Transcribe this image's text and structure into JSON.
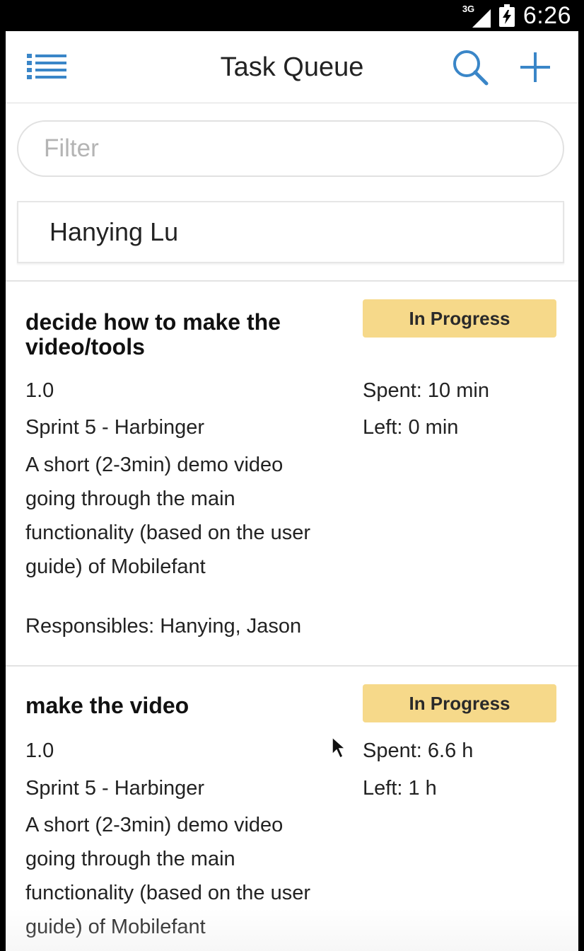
{
  "status_bar": {
    "network": "3G",
    "time": "6:26"
  },
  "header": {
    "title": "Task Queue"
  },
  "filter": {
    "placeholder": "Filter",
    "value": ""
  },
  "assignee": "Hanying Lu",
  "tasks": [
    {
      "name": "decide how to make the video/tools",
      "status": "In Progress",
      "version": "1.0",
      "sprint": "Sprint 5 - Harbinger",
      "description": "A short (2-3min) demo video going through the main functionality (based on the user guide) of Mobilefant",
      "spent": "Spent: 10 min",
      "left": "Left: 0 min",
      "responsibles": "Responsibles: Hanying, Jason"
    },
    {
      "name": "make the video",
      "status": "In Progress",
      "version": "1.0",
      "sprint": "Sprint 5 - Harbinger",
      "description": "A short (2-3min) demo video going through the main functionality (based on the user guide) of Mobilefant",
      "spent": "Spent: 6.6 h",
      "left": "Left: 1 h"
    }
  ],
  "colors": {
    "accent": "#3a86c8",
    "status_badge": "#f6d98a"
  }
}
